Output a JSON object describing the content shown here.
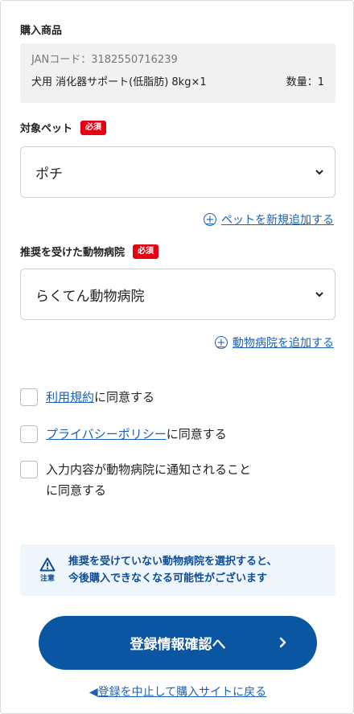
{
  "purchase": {
    "title": "購入商品",
    "jan": "JANコード：3182550716239",
    "product_name": "犬用 消化器サポート(低脂肪) 8kg×1",
    "quantity": "数量：1"
  },
  "pet": {
    "label": "対象ペット",
    "required_badge": "必須",
    "selected": "ポチ",
    "add_link": "ペットを新規追加する"
  },
  "hospital": {
    "label": "推奨を受けた動物病院",
    "required_badge": "必須",
    "selected": "らくてん動物病院",
    "add_link": "動物病院を追加する"
  },
  "agreements": {
    "terms_link": "利用規約",
    "terms_suffix": "に同意する",
    "privacy_link": "プライバシーポリシー",
    "privacy_suffix": "に同意する",
    "notify_line1": "入力内容が動物病院に通知されること",
    "notify_line2": "に同意する"
  },
  "notice": {
    "icon_label": "注意",
    "line1": "推奨を受けていない動物病院を選択すると、",
    "line2": "今後購入できなくなる可能性がございます"
  },
  "actions": {
    "confirm_label": "登録情報確認へ",
    "back_arrow": "◀",
    "back_label": "登録を中止して購入サイトに戻る"
  },
  "colors": {
    "accent_blue": "#0a56a3",
    "link_blue": "#1b61b8",
    "required_red": "#e60012",
    "notice_bg": "#eef5fb"
  }
}
